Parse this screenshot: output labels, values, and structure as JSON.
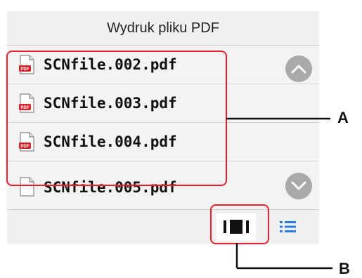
{
  "header": {
    "title": "Wydruk pliku PDF"
  },
  "files": [
    {
      "name": "SCNfile.002.pdf",
      "icon": "pdf-file-icon"
    },
    {
      "name": "SCNfile.003.pdf",
      "icon": "pdf-file-icon"
    },
    {
      "name": "SCNfile.004.pdf",
      "icon": "pdf-file-icon"
    },
    {
      "name": "SCNfile.005.pdf",
      "icon": "pdf-file-icon"
    }
  ],
  "scroll": {
    "up_icon": "chevron-up-icon",
    "down_icon": "chevron-down-icon"
  },
  "view_toggle": {
    "single_icon": "single-view-icon",
    "list_icon": "list-view-icon",
    "selected": "single"
  },
  "callouts": {
    "a": "A",
    "b": "B"
  },
  "colors": {
    "callout": "#e8202a",
    "list_icon": "#2a7de1",
    "pdf_badge": "#d9232a",
    "scroll_button": "#a9a9a9"
  }
}
